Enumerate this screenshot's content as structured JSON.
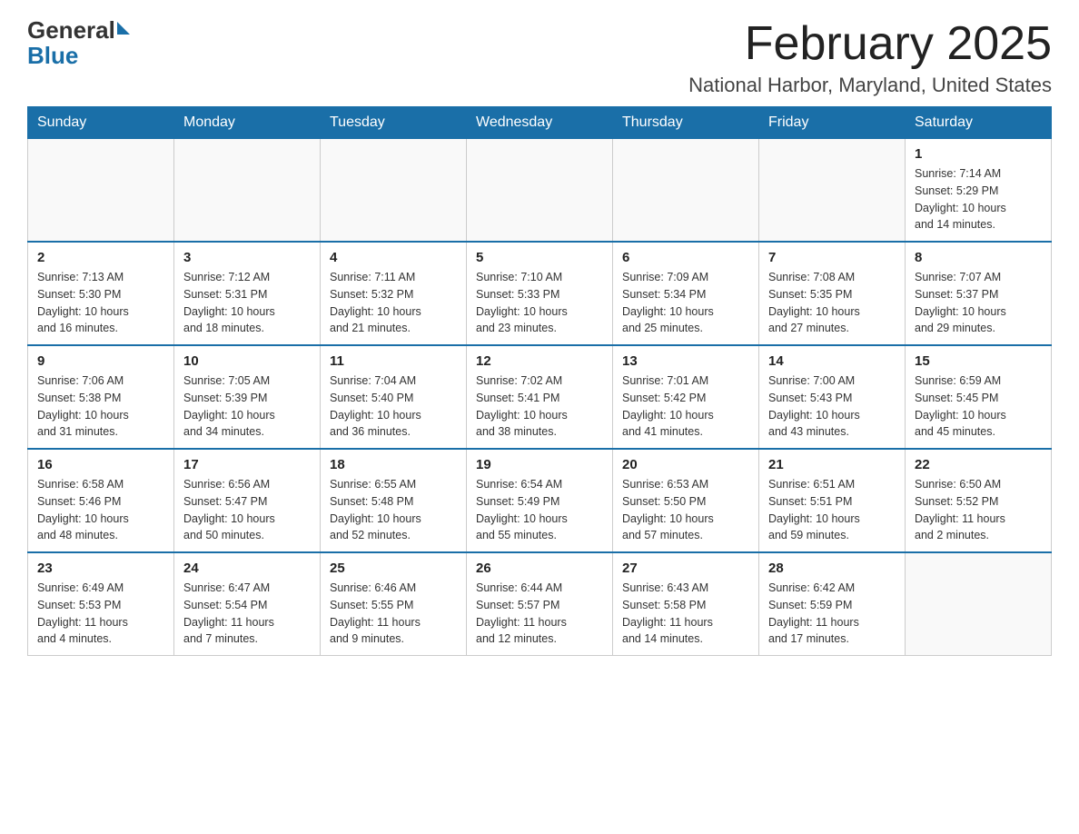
{
  "logo": {
    "general": "General",
    "blue": "Blue"
  },
  "header": {
    "month_title": "February 2025",
    "location": "National Harbor, Maryland, United States"
  },
  "days_of_week": [
    "Sunday",
    "Monday",
    "Tuesday",
    "Wednesday",
    "Thursday",
    "Friday",
    "Saturday"
  ],
  "weeks": [
    [
      {
        "day": "",
        "info": ""
      },
      {
        "day": "",
        "info": ""
      },
      {
        "day": "",
        "info": ""
      },
      {
        "day": "",
        "info": ""
      },
      {
        "day": "",
        "info": ""
      },
      {
        "day": "",
        "info": ""
      },
      {
        "day": "1",
        "info": "Sunrise: 7:14 AM\nSunset: 5:29 PM\nDaylight: 10 hours\nand 14 minutes."
      }
    ],
    [
      {
        "day": "2",
        "info": "Sunrise: 7:13 AM\nSunset: 5:30 PM\nDaylight: 10 hours\nand 16 minutes."
      },
      {
        "day": "3",
        "info": "Sunrise: 7:12 AM\nSunset: 5:31 PM\nDaylight: 10 hours\nand 18 minutes."
      },
      {
        "day": "4",
        "info": "Sunrise: 7:11 AM\nSunset: 5:32 PM\nDaylight: 10 hours\nand 21 minutes."
      },
      {
        "day": "5",
        "info": "Sunrise: 7:10 AM\nSunset: 5:33 PM\nDaylight: 10 hours\nand 23 minutes."
      },
      {
        "day": "6",
        "info": "Sunrise: 7:09 AM\nSunset: 5:34 PM\nDaylight: 10 hours\nand 25 minutes."
      },
      {
        "day": "7",
        "info": "Sunrise: 7:08 AM\nSunset: 5:35 PM\nDaylight: 10 hours\nand 27 minutes."
      },
      {
        "day": "8",
        "info": "Sunrise: 7:07 AM\nSunset: 5:37 PM\nDaylight: 10 hours\nand 29 minutes."
      }
    ],
    [
      {
        "day": "9",
        "info": "Sunrise: 7:06 AM\nSunset: 5:38 PM\nDaylight: 10 hours\nand 31 minutes."
      },
      {
        "day": "10",
        "info": "Sunrise: 7:05 AM\nSunset: 5:39 PM\nDaylight: 10 hours\nand 34 minutes."
      },
      {
        "day": "11",
        "info": "Sunrise: 7:04 AM\nSunset: 5:40 PM\nDaylight: 10 hours\nand 36 minutes."
      },
      {
        "day": "12",
        "info": "Sunrise: 7:02 AM\nSunset: 5:41 PM\nDaylight: 10 hours\nand 38 minutes."
      },
      {
        "day": "13",
        "info": "Sunrise: 7:01 AM\nSunset: 5:42 PM\nDaylight: 10 hours\nand 41 minutes."
      },
      {
        "day": "14",
        "info": "Sunrise: 7:00 AM\nSunset: 5:43 PM\nDaylight: 10 hours\nand 43 minutes."
      },
      {
        "day": "15",
        "info": "Sunrise: 6:59 AM\nSunset: 5:45 PM\nDaylight: 10 hours\nand 45 minutes."
      }
    ],
    [
      {
        "day": "16",
        "info": "Sunrise: 6:58 AM\nSunset: 5:46 PM\nDaylight: 10 hours\nand 48 minutes."
      },
      {
        "day": "17",
        "info": "Sunrise: 6:56 AM\nSunset: 5:47 PM\nDaylight: 10 hours\nand 50 minutes."
      },
      {
        "day": "18",
        "info": "Sunrise: 6:55 AM\nSunset: 5:48 PM\nDaylight: 10 hours\nand 52 minutes."
      },
      {
        "day": "19",
        "info": "Sunrise: 6:54 AM\nSunset: 5:49 PM\nDaylight: 10 hours\nand 55 minutes."
      },
      {
        "day": "20",
        "info": "Sunrise: 6:53 AM\nSunset: 5:50 PM\nDaylight: 10 hours\nand 57 minutes."
      },
      {
        "day": "21",
        "info": "Sunrise: 6:51 AM\nSunset: 5:51 PM\nDaylight: 10 hours\nand 59 minutes."
      },
      {
        "day": "22",
        "info": "Sunrise: 6:50 AM\nSunset: 5:52 PM\nDaylight: 11 hours\nand 2 minutes."
      }
    ],
    [
      {
        "day": "23",
        "info": "Sunrise: 6:49 AM\nSunset: 5:53 PM\nDaylight: 11 hours\nand 4 minutes."
      },
      {
        "day": "24",
        "info": "Sunrise: 6:47 AM\nSunset: 5:54 PM\nDaylight: 11 hours\nand 7 minutes."
      },
      {
        "day": "25",
        "info": "Sunrise: 6:46 AM\nSunset: 5:55 PM\nDaylight: 11 hours\nand 9 minutes."
      },
      {
        "day": "26",
        "info": "Sunrise: 6:44 AM\nSunset: 5:57 PM\nDaylight: 11 hours\nand 12 minutes."
      },
      {
        "day": "27",
        "info": "Sunrise: 6:43 AM\nSunset: 5:58 PM\nDaylight: 11 hours\nand 14 minutes."
      },
      {
        "day": "28",
        "info": "Sunrise: 6:42 AM\nSunset: 5:59 PM\nDaylight: 11 hours\nand 17 minutes."
      },
      {
        "day": "",
        "info": ""
      }
    ]
  ]
}
